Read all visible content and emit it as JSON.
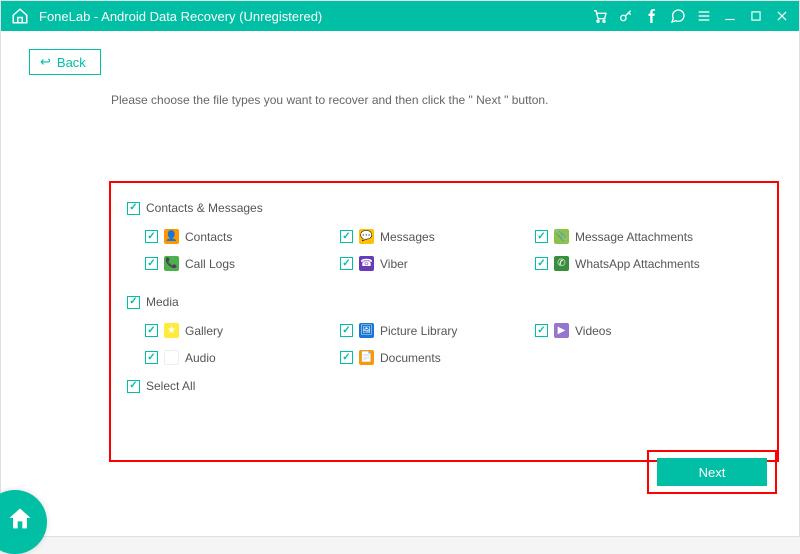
{
  "window": {
    "title": "FoneLab - Android Data Recovery (Unregistered)"
  },
  "back_label": "Back",
  "instruction": "Please choose the file types you want to recover and then click the \" Next \" button.",
  "sections": {
    "contacts_messages": {
      "label": "Contacts & Messages",
      "items": {
        "contacts": "Contacts",
        "messages": "Messages",
        "msg_attachments": "Message Attachments",
        "call_logs": "Call Logs",
        "viber": "Viber",
        "whatsapp_attachments": "WhatsApp Attachments"
      }
    },
    "media": {
      "label": "Media",
      "items": {
        "gallery": "Gallery",
        "picture_library": "Picture Library",
        "videos": "Videos",
        "audio": "Audio",
        "documents": "Documents"
      }
    }
  },
  "select_all_label": "Select All",
  "next_label": "Next",
  "colors": {
    "accent": "#00bfa5",
    "highlight_border": "#ff0000"
  }
}
